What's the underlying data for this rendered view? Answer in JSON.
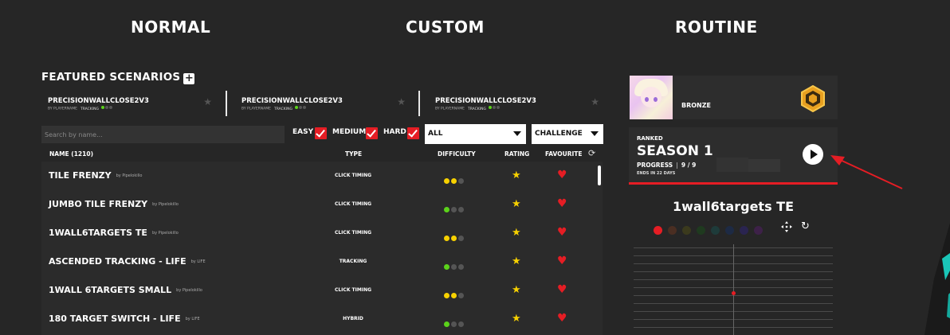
{
  "nav": {
    "normal": "NORMAL",
    "custom": "CUSTOM",
    "routine": "ROUTINE"
  },
  "featured": {
    "title": "FEATURED SCENARIOS",
    "plus_glyph": "+",
    "cards": [
      {
        "name": "PRECISIONWALLCLOSE2V3",
        "by": "BY PLAYERNAME",
        "tag": "TRACKING"
      },
      {
        "name": "PRECISIONWALLCLOSE2V3",
        "by": "BY PLAYERNAME",
        "tag": "TRACKING"
      },
      {
        "name": "PRECISIONWALLCLOSE2V3",
        "by": "BY PLAYERNAME",
        "tag": "TRACKING"
      }
    ]
  },
  "filters": {
    "search_placeholder": "Search by name...",
    "easy": "EASY",
    "medium": "MEDIUM",
    "hard": "HARD",
    "category_value": "ALL",
    "mode_value": "CHALLENGE"
  },
  "table": {
    "headers": {
      "name": "NAME (1210)",
      "type": "TYPE",
      "difficulty": "DIFFICULTY",
      "rating": "RATING",
      "favourite": "FAVOURITE"
    },
    "rows": [
      {
        "name": "TILE FRENZY",
        "by": "by Pipelokillo",
        "type": "CLICK TIMING",
        "difficulty": 2
      },
      {
        "name": "JUMBO TILE FRENZY",
        "by": "by Pipelokillo",
        "type": "CLICK TIMING",
        "difficulty": 1
      },
      {
        "name": "1WALL6TARGETS TE",
        "by": "by Pipelokillo",
        "type": "CLICK TIMING",
        "difficulty": 2
      },
      {
        "name": "ASCENDED TRACKING - LIFE",
        "by": "by LIFE",
        "type": "TRACKING",
        "difficulty": 1
      },
      {
        "name": "1WALL 6TARGETS SMALL",
        "by": "by Pipelokillo",
        "type": "CLICK TIMING",
        "difficulty": 2
      },
      {
        "name": "180 TARGET SWITCH - LIFE",
        "by": "by LIFE",
        "type": "HYBRID",
        "difficulty": 1
      }
    ]
  },
  "profile": {
    "rank": "BRONZE"
  },
  "ranked": {
    "label": "RANKED",
    "season": "SEASON 1",
    "progress_label": "PROGRESS",
    "progress_value": "9 / 9",
    "ends": "ENDS IN 22 DAYS"
  },
  "scenario_preview": {
    "title": "1wall6targets TE",
    "colors": [
      "#e51d24",
      "#4a2e22",
      "#3b3a1d",
      "#1f3a1f",
      "#1e3b3a",
      "#1d2a44",
      "#2a2450",
      "#3d2148"
    ]
  },
  "icons": {
    "star": "★",
    "heart": "♥",
    "refresh": "⟳",
    "reset": "↻"
  }
}
